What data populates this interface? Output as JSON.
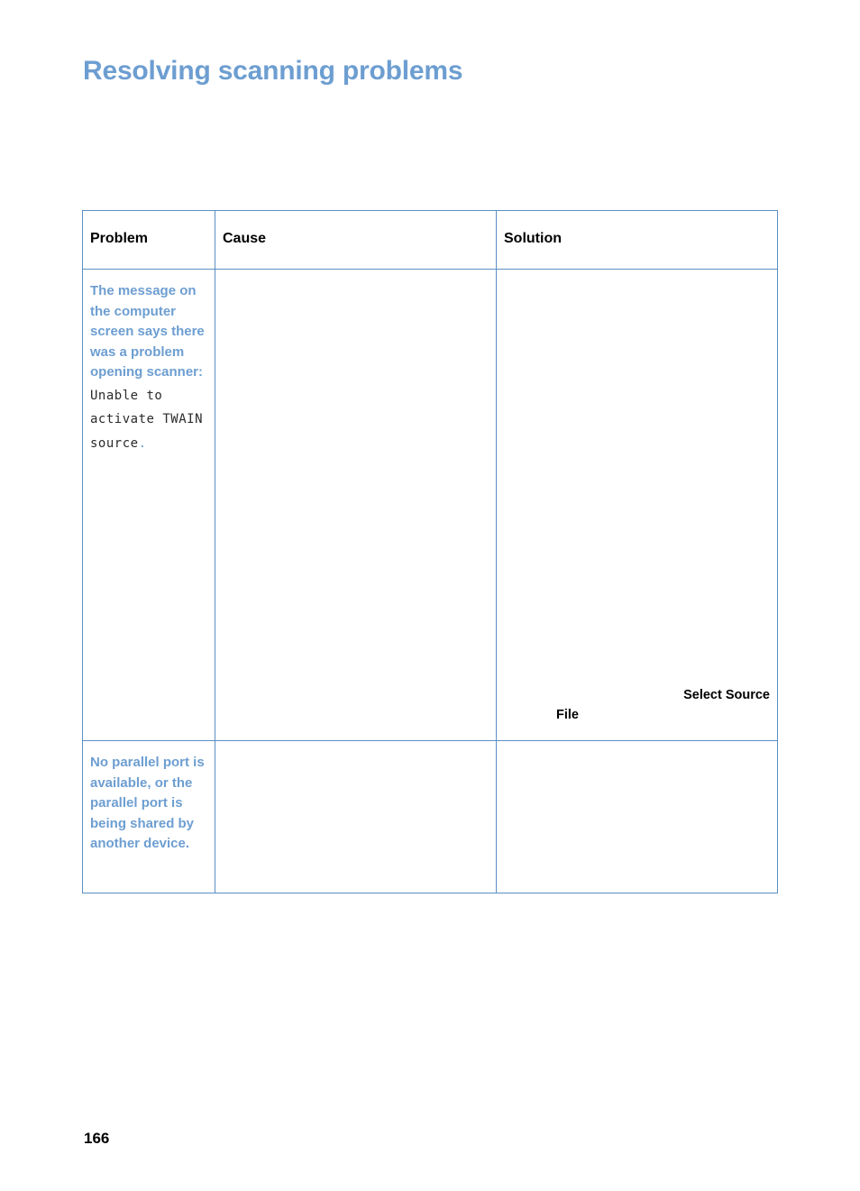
{
  "document": {
    "title": "Resolving scanning problems",
    "page_number": "166",
    "accent_color": "#6d9ed1",
    "border_color": "#5b8fc4",
    "text_color": "#000000"
  },
  "table": {
    "columns": [
      {
        "id": "problem",
        "header": "Problem"
      },
      {
        "id": "cause",
        "header": "Cause"
      },
      {
        "id": "solution",
        "header": "Solution"
      }
    ],
    "rows": [
      {
        "problem_heading": "The message on the computer screen says there was a problem opening scanner:",
        "problem_message": "Unable to activate TWAIN source",
        "problem_message_trailing": ".",
        "cause": "",
        "solution_fragments": [
          {
            "text": "Select Source",
            "align": "right"
          },
          {
            "text": "File",
            "align": "left"
          }
        ]
      },
      {
        "problem_heading": "No parallel port is available, or the parallel port is being shared by another device.",
        "problem_message": "",
        "problem_message_trailing": "",
        "cause": "",
        "solution_fragments": []
      }
    ]
  }
}
